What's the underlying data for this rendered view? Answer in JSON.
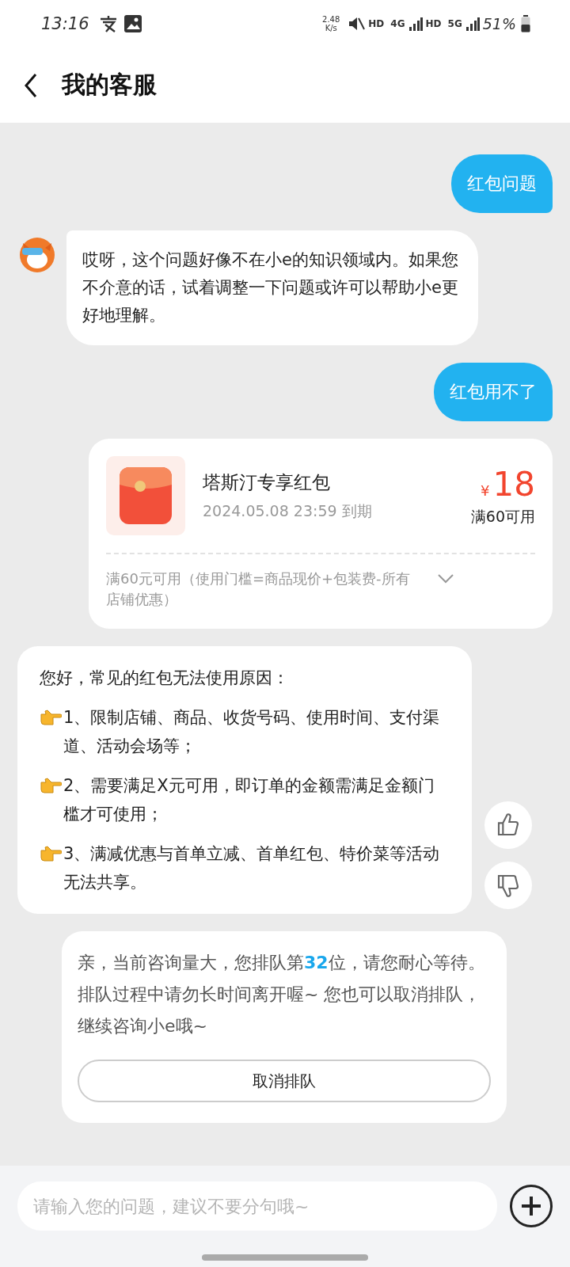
{
  "status_bar": {
    "time": "13:16",
    "speed": [
      "2.48",
      "K/s"
    ],
    "network_labels": [
      "HD",
      "4G",
      "HD",
      "5G"
    ],
    "battery": "51%"
  },
  "header": {
    "title": "我的客服"
  },
  "messages": [
    {
      "kind": "user",
      "text": "红包问题"
    },
    {
      "kind": "bot",
      "text": "哎呀，这个问题好像不在小e的知识领域内。如果您不介意的话，试着调整一下问题或许可以帮助小e更好地理解。"
    },
    {
      "kind": "user",
      "text": "红包用不了"
    },
    {
      "kind": "coupon",
      "name": "塔斯汀专享红包",
      "expiry": "2024.05.08 23:59 到期",
      "currency": "¥",
      "amount": "18",
      "condition": "满60可用",
      "detail": "满60元可用（使用门槛=商品现价+包装费-所有店铺优惠）",
      "expanded": false
    },
    {
      "kind": "list",
      "intro": "您好，常见的红包无法使用原因：",
      "items": [
        "1、限制店铺、商品、收货号码、使用时间、支付渠道、活动会场等；",
        "2、需要满足X元可用，即订单的金额需满足金额门槛才可使用；",
        "3、满减优惠与首单立减、首单红包、特价菜等活动无法共享。"
      ]
    },
    {
      "kind": "queue",
      "segments": [
        {
          "text": "亲，当前咨询量大，您排队第",
          "highlight": false
        },
        {
          "text": "32",
          "highlight": true
        },
        {
          "text": "位，请您耐心等待。排队过程中请勿长时间离开喔~ 您也可以取消排队，继续咨询小e哦~",
          "highlight": false
        }
      ],
      "button": "取消排队"
    }
  ],
  "input": {
    "placeholder": "请输入您的问题，建议不要分句哦~"
  }
}
